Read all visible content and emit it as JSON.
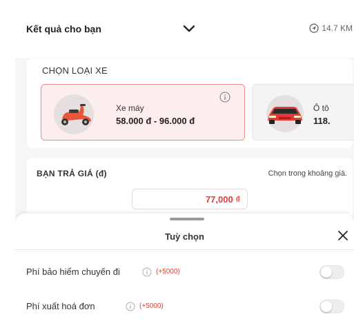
{
  "header": {
    "title": "Kết quả cho bạn",
    "distance": "14.7 KM"
  },
  "vehicle_section": {
    "title": "CHỌN LOẠI XE",
    "options": [
      {
        "name": "Xe máy",
        "price": "58.000 đ - 96.000 đ",
        "icon": "scooter-icon",
        "selected": true
      },
      {
        "name": "Ô tô",
        "price": "118.",
        "icon": "car-icon",
        "selected": false
      }
    ]
  },
  "price_section": {
    "title": "BẠN TRẢ GIÁ (đ)",
    "hint": "Chọn trong khoảng giá.",
    "value": "77,000 ₫"
  },
  "options_sheet": {
    "title": "Tuỳ chọn",
    "items": [
      {
        "label": "Phí bảo hiểm chuyến đi",
        "extra": "(+5000)",
        "enabled": false
      },
      {
        "label": "Phí xuất hoá đơn",
        "extra": "(+5000)",
        "enabled": false
      }
    ]
  },
  "colors": {
    "accent": "#e53935",
    "selected_border": "#f08a8a",
    "selected_bg": "#fdeeee"
  }
}
